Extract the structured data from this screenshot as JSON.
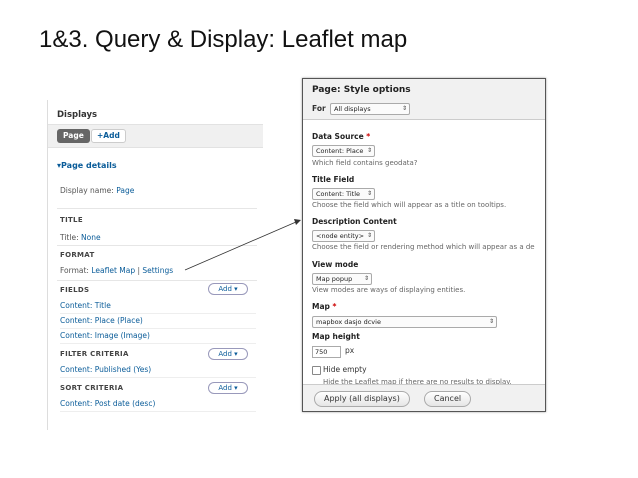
{
  "slide": {
    "title": "1&3. Query & Display: Leaflet map"
  },
  "views": {
    "displays_title": "Displays",
    "tabs": {
      "page": "Page",
      "add": "+Add"
    },
    "page_details": "▾Page details",
    "display_name_label": "Display name:",
    "display_name_value": "Page",
    "title_section": "TITLE",
    "title_label": "Title:",
    "title_value": "None",
    "format_section": "FORMAT",
    "format_label": "Format:",
    "format_value": "Leaflet Map",
    "format_sep": "|",
    "format_settings": "Settings",
    "fields_section": "FIELDS",
    "fields": [
      "Content: Title",
      "Content: Place (Place)",
      "Content: Image (Image)"
    ],
    "filter_section": "FILTER CRITERIA",
    "filters": [
      "Content: Published (Yes)"
    ],
    "sort_section": "SORT CRITERIA",
    "sorts": [
      "Content: Post date (desc)"
    ],
    "add_label": "Add",
    "add_arrow": "▾"
  },
  "dialog": {
    "title": "Page: Style options",
    "for_label": "For",
    "for_value": "All displays",
    "data_source_label": "Data Source",
    "data_source_value": "Content: Place",
    "data_source_help": "Which field contains geodata?",
    "title_field_label": "Title Field",
    "title_field_value": "Content: Title",
    "title_field_help": "Choose the field which will appear as a title on tooltips.",
    "description_label": "Description Content",
    "description_value": "<node entity>",
    "description_help": "Choose the field or rendering method which will appear as a de",
    "view_mode_label": "View mode",
    "view_mode_value": "Map popup",
    "view_mode_help": "View modes are ways of displaying entities.",
    "map_label": "Map",
    "map_value": "mapbox dasjo dcvie",
    "map_height_label": "Map height",
    "map_height_value": "750",
    "map_height_unit": "px",
    "hide_empty_label": "Hide empty",
    "hide_empty_help": "Hide the Leaflet map if there are no results to display.",
    "required_mark": "*",
    "select_arrow": "⇕",
    "apply_button": "Apply (all displays)",
    "cancel_button": "Cancel"
  }
}
